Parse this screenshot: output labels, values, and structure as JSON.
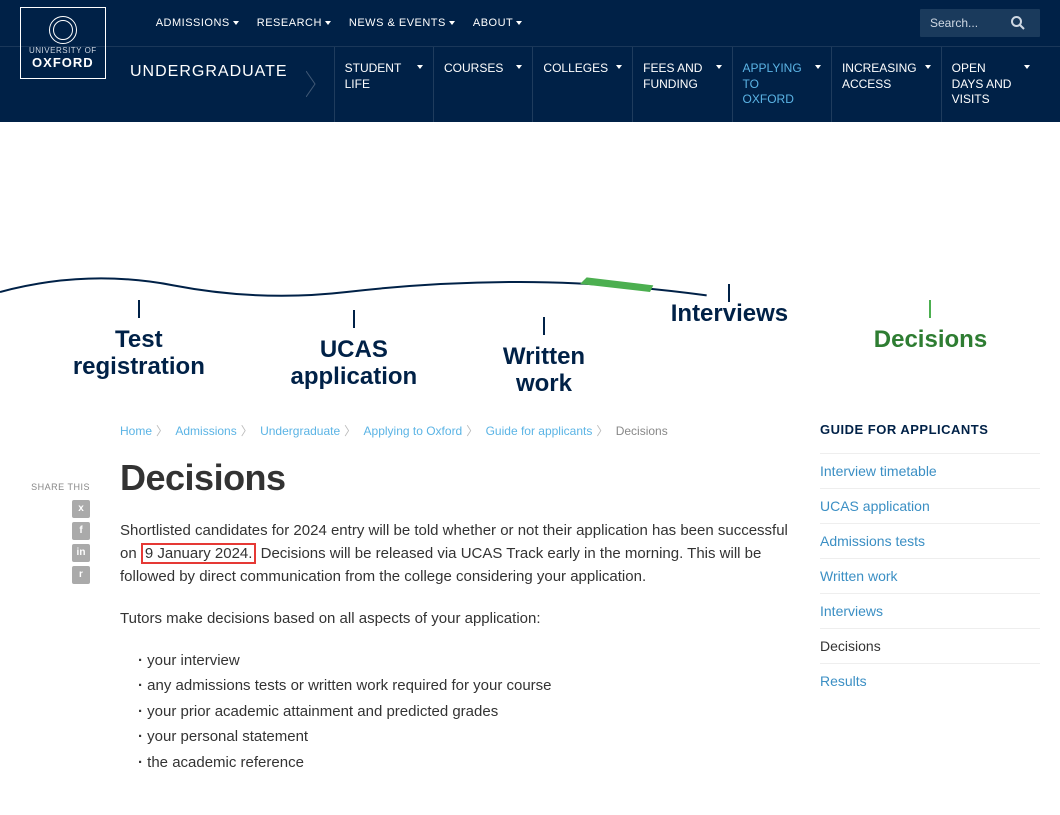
{
  "logo": {
    "line1": "UNIVERSITY OF",
    "line2": "OXFORD"
  },
  "topnav": [
    "ADMISSIONS",
    "RESEARCH",
    "NEWS & EVENTS",
    "ABOUT"
  ],
  "search": {
    "placeholder": "Search..."
  },
  "section": "UNDERGRADUATE",
  "mainnav": [
    {
      "label": "STUDENT LIFE"
    },
    {
      "label": "COURSES"
    },
    {
      "label": "COLLEGES"
    },
    {
      "label": "FEES AND FUNDING"
    },
    {
      "label": "APPLYING TO OXFORD",
      "active": true
    },
    {
      "label": "INCREASING ACCESS"
    },
    {
      "label": "OPEN DAYS AND VISITS"
    }
  ],
  "timeline": [
    {
      "label": "Test\nregistration"
    },
    {
      "label": "UCAS\napplication"
    },
    {
      "label": "Written\nwork"
    },
    {
      "label": "Interviews"
    },
    {
      "label": "Decisions",
      "active": true
    }
  ],
  "share": {
    "title": "SHARE THIS",
    "icons": [
      "x",
      "f",
      "in",
      "r"
    ]
  },
  "breadcrumb": [
    "Home",
    "Admissions",
    "Undergraduate",
    "Applying to Oxford",
    "Guide for applicants",
    "Decisions"
  ],
  "page": {
    "title": "Decisions",
    "para1_a": "Shortlisted candidates for 2024 entry will be told whether or not their application has been successful on ",
    "para1_highlight": "9 January 2024.",
    "para1_b": " Decisions will be released via UCAS Track early in the morning. This will be followed by direct communication from the college considering your application.",
    "para2": "Tutors make decisions based on all aspects of your application:",
    "bullets": [
      "your interview",
      "any admissions tests or written work required for your course",
      "your prior academic attainment and predicted grades",
      "your personal statement",
      "the academic reference"
    ]
  },
  "sidebar": {
    "title": "GUIDE FOR APPLICANTS",
    "links": [
      {
        "label": "Interview timetable"
      },
      {
        "label": "UCAS application"
      },
      {
        "label": "Admissions tests"
      },
      {
        "label": "Written work"
      },
      {
        "label": "Interviews"
      },
      {
        "label": "Decisions",
        "current": true
      },
      {
        "label": "Results"
      }
    ]
  }
}
